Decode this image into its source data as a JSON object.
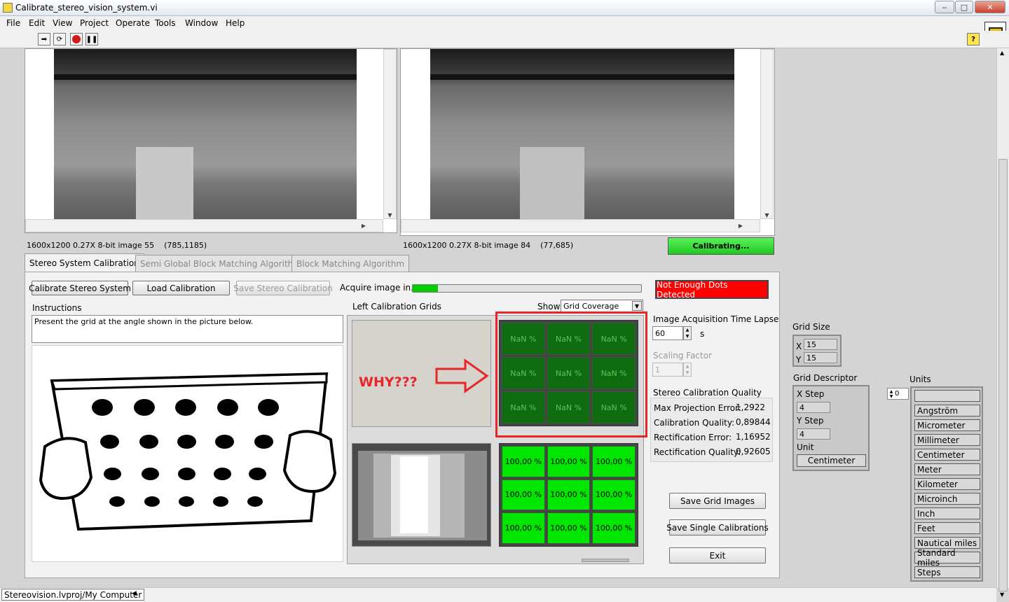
{
  "window": {
    "title": "Calibrate_stereo_vision_system.vi"
  },
  "menu": [
    "File",
    "Edit",
    "View",
    "Project",
    "Operate",
    "Tools",
    "Window",
    "Help"
  ],
  "images": {
    "left": {
      "info": "1600x1200 0.27X 8-bit image 55",
      "coords": "(785,1185)"
    },
    "right": {
      "info": "1600x1200 0.27X 8-bit image 84",
      "coords": "(77,685)"
    }
  },
  "status": {
    "calibrating": "Calibrating...",
    "not_enough": "Not Enough Dots Detected"
  },
  "tabs": [
    "Stereo System Calibration",
    "Semi Global Block Matching Algorithm",
    "Block Matching Algorithm"
  ],
  "buttons": {
    "calibrate": "Calibrate Stereo System",
    "load": "Load Calibration",
    "save_stereo": "Save Stereo Calibration",
    "save_grid": "Save Grid Images",
    "save_single": "Save Single Calibrations",
    "exit": "Exit"
  },
  "acquire": {
    "label": "Acquire image in...",
    "progress": 0.11
  },
  "instructions": {
    "label": "Instructions",
    "text": "Present the grid at the angle shown in the picture below."
  },
  "grids": {
    "label": "Left Calibration Grids",
    "show_label": "Show",
    "show_value": "Grid Coverage",
    "annotation": "WHY???",
    "top_cells": [
      "NaN %",
      "NaN %",
      "NaN %",
      "NaN %",
      "NaN %",
      "NaN %",
      "NaN %",
      "NaN %",
      "NaN %"
    ],
    "bottom_cells": [
      "100,00 %",
      "100,00 %",
      "100,00 %",
      "100,00 %",
      "100,00 %",
      "100,00 %",
      "100,00 %",
      "100,00 %",
      "100,00 %"
    ]
  },
  "acq_time": {
    "label": "Image Acquisition Time Lapse",
    "value": "60",
    "unit": "s"
  },
  "scaling": {
    "label": "Scaling Factor",
    "value": "1"
  },
  "quality": {
    "label": "Stereo Calibration Quality",
    "rows": [
      {
        "k": "Max Projection Error:",
        "v": "1,2922"
      },
      {
        "k": "Calibration Quality:",
        "v": "0,89844"
      },
      {
        "k": "Rectification Error:",
        "v": "1,16952"
      },
      {
        "k": "Rectification Quality:",
        "v": "0,92605"
      }
    ]
  },
  "grid_size": {
    "label": "Grid Size",
    "x_label": "X",
    "x": "15",
    "y_label": "Y",
    "y": "15"
  },
  "grid_desc": {
    "label": "Grid Descriptor",
    "xstep_label": "X Step",
    "xstep": "4",
    "ystep_label": "Y Step",
    "ystep": "4",
    "unit_label": "Unit",
    "unit": "Centimeter"
  },
  "units": {
    "label": "Units",
    "index": "0",
    "items": [
      "",
      "Angström",
      "Micrometer",
      "Millimeter",
      "Centimeter",
      "Meter",
      "Kilometer",
      "Microinch",
      "Inch",
      "Feet",
      "Nautical miles",
      "Standard miles",
      "Steps"
    ]
  },
  "footer": {
    "path": "Stereovision.lvproj/My Computer"
  },
  "colors": {
    "calibrating": "#33dd33",
    "alert": "#ff0000",
    "annotation": "#e8262a"
  }
}
